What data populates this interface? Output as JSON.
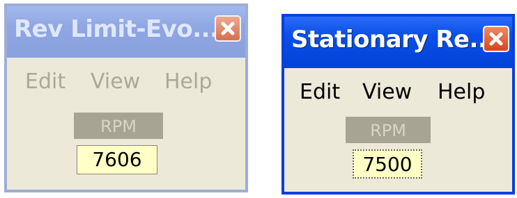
{
  "windows": [
    {
      "title": "Rev Limit-Evo...",
      "state": "inactive",
      "menu": [
        "Edit",
        "View",
        "Help"
      ],
      "rpm_label": "RPM",
      "rpm_value": "7606"
    },
    {
      "title": "Stationary Re...",
      "state": "active",
      "menu": [
        "Edit",
        "View",
        "Help"
      ],
      "rpm_label": "RPM",
      "rpm_value": "7500"
    }
  ],
  "icons": {
    "close": "close-icon"
  },
  "colors": {
    "inactive_title_bar": "#8fa6e3",
    "active_title_bar": "#0a50e8",
    "window_body": "#ece9d8",
    "rpm_value_bg": "#ffffc6",
    "rpm_header_bg": "#a8a493",
    "close_button": "#d9451c"
  }
}
